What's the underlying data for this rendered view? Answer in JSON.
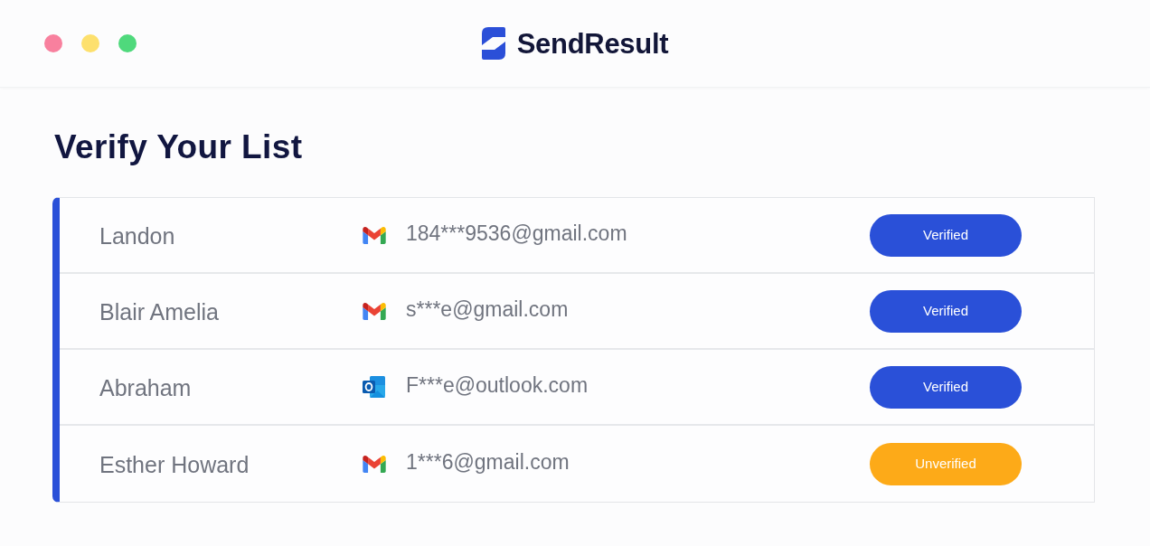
{
  "header": {
    "brand": "SendResult"
  },
  "title": "Verify Your List",
  "rows": [
    {
      "name": "Landon",
      "kind": "gmail",
      "email": "184***9536@gmail.com",
      "status": "Verified",
      "color": "#2a50d8"
    },
    {
      "name": "Blair Amelia",
      "kind": "gmail",
      "email": "s***e@gmail.com",
      "status": "Verified",
      "color": "#2a50d8"
    },
    {
      "name": "Abraham",
      "kind": "outlook",
      "email": "F***e@outlook.com",
      "status": "Verified",
      "color": "#2a50d8"
    },
    {
      "name": "Esther Howard",
      "kind": "gmail",
      "email": "1***6@gmail.com",
      "status": "Unverified",
      "color": "#fdaa18"
    }
  ]
}
